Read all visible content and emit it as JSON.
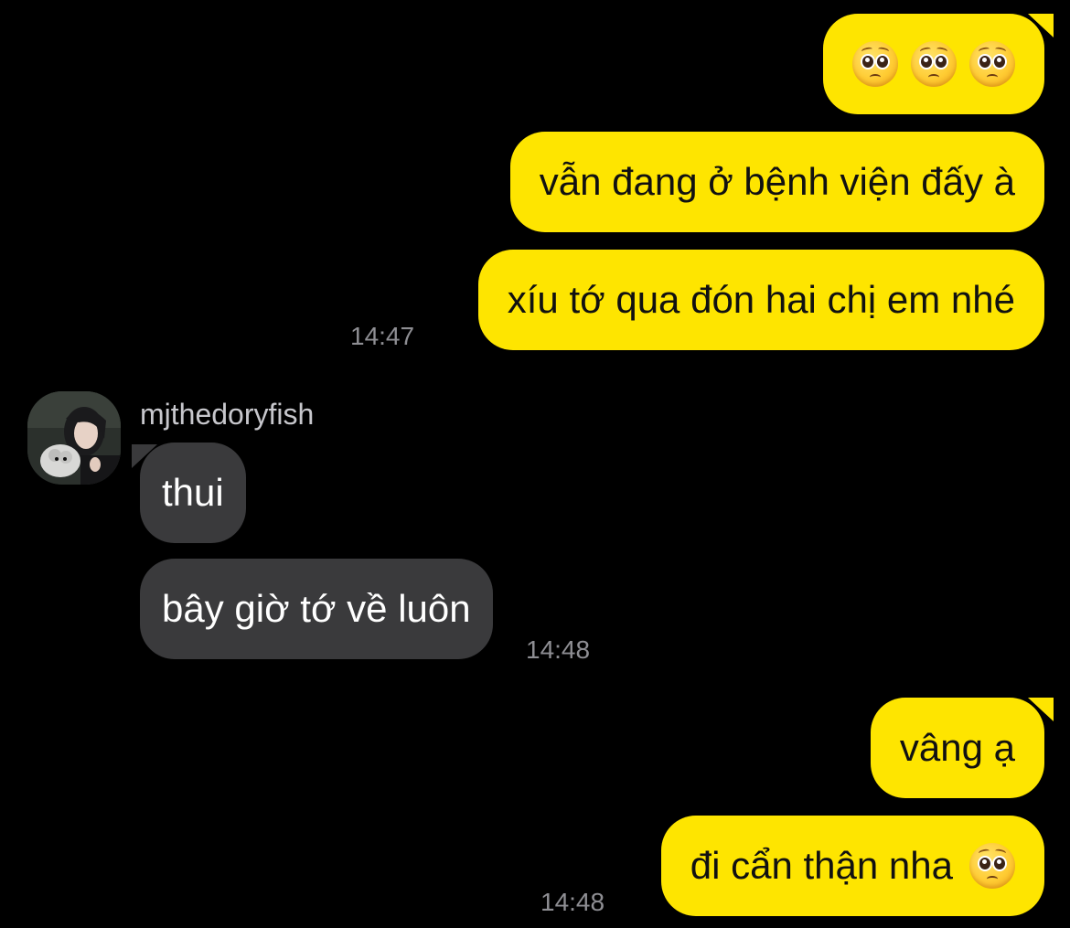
{
  "conversation": {
    "outgoing_group_1": {
      "msg_emoji_count": 3,
      "msg_2": "vẫn đang ở bệnh viện đấy à",
      "msg_3": "xíu tớ qua đón hai chị em nhé",
      "time": "14:47"
    },
    "incoming_group": {
      "sender": "mjthedoryfish",
      "msg_1": "thui",
      "msg_2": "bây giờ tớ về luôn",
      "time": "14:48"
    },
    "outgoing_group_2": {
      "msg_1": "vâng ạ",
      "msg_2": "đi cẩn thận nha",
      "time": "14:48"
    }
  },
  "icons": {
    "emoji": "pleading-face-emoji",
    "avatar": "profile-photo"
  },
  "colors": {
    "background": "#000000",
    "outgoing_bubble": "#FEE500",
    "incoming_bubble": "#3A3A3C",
    "timestamp": "#8E8E93"
  }
}
